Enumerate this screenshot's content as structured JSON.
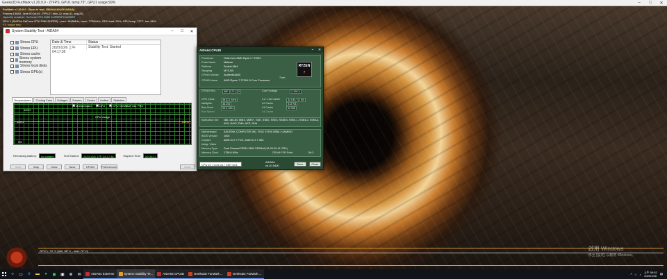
{
  "furmark": {
    "window_title": "Geeks3D FurMark v1.20.9.0 - 27FPS, GPU1 temp:73°, GPU1 usage:99%",
    "overlay": [
      "FurMark v1.20.9.0 - Burn-in test, 2560x1440 (8X MSAA)",
      "Frames:19080 - time:00:06:45 - FPS:27 (min:22, max:31, avg:28)",
      "OpenGL renderer: GeForce RTX 2080 SUPER/PCIe/SSE2",
      "GPU 1 (NVIDIA GeForce RTX 2080 SUPER) - core: 1845MHz, mem: 7750MHz, GPU load: 99%, GPU temp: 73°C, fan: 66%",
      "F1: toggle help"
    ],
    "graph_label": "GPU 1: 73° C (min: 38° C - max: 73° C)",
    "watermark_line1": "啟用 Windows",
    "watermark_line2": "移至 [設定] 以啟用 Windows。"
  },
  "sst": {
    "title": "System Stability Test - AIDA64",
    "stress_options": [
      {
        "label": "Stress CPU",
        "checked": false
      },
      {
        "label": "Stress FPU",
        "checked": true
      },
      {
        "label": "Stress cache",
        "checked": false
      },
      {
        "label": "Stress system memory",
        "checked": false
      },
      {
        "label": "Stress local disks",
        "checked": false
      },
      {
        "label": "Stress GPU(s)",
        "checked": false
      }
    ],
    "table": {
      "col1": "Date & Time",
      "col2": "Status",
      "rows": [
        {
          "datetime": "2020/10/6 上午 04:17:36",
          "status": "Stability Test: Started"
        }
      ]
    },
    "tabs": [
      "Temperatures",
      "Cooling Fans",
      "Voltages",
      "Powers",
      "Clocks",
      "Unified",
      "Statistics"
    ],
    "temp_graph": {
      "legend": [
        "Motherboard",
        "CPU",
        "CPU GIGABAT 811 PRO"
      ],
      "y_top": "100°C",
      "y_bottom": "0°C",
      "value": "78 36"
    },
    "cpu_graph": {
      "title": "CPU Usage",
      "y_top": "100%",
      "y_bottom": "0%",
      "value": "100%"
    },
    "info": {
      "battery_label": "Remaining Battery:",
      "battery_value": "No battery",
      "started_label": "Test Started:",
      "started_value": "2020/10/6 上午 04:17:36",
      "elapsed_label": "Elapsed Time:",
      "elapsed_value": "00:06:21"
    },
    "buttons": {
      "start": "Start",
      "stop": "Stop",
      "clear": "Clear",
      "save": "Save",
      "cpuid": "CPUID",
      "preferences": "Preferences",
      "close": "Close"
    }
  },
  "cpuid": {
    "title": "AIDA64 CPUID",
    "processor": {
      "label": "Processor",
      "value": "Octa-Core AMD Ryzen 7 3700X"
    },
    "code_name": {
      "label": "Code Name",
      "value": "Matisse"
    },
    "platform": {
      "label": "Platform",
      "value": "Socket AM4"
    },
    "stepping": {
      "label": "Stepping",
      "value": "MTS-B0"
    },
    "vendor": {
      "label": "CPUID Vendor",
      "value": "AuthenticAMD",
      "nm": "7 nm"
    },
    "cpuid_name": {
      "label": "CPUID Name",
      "value": "AMD Ryzen 7 3700X 8-Core Processor"
    },
    "rev": {
      "label": "CPUID Rev.",
      "v1": "08F",
      "v2": "71",
      "v3": "0"
    },
    "core_voltage": {
      "label": "Core Voltage",
      "value": "1.100 V"
    },
    "clocks": [
      {
        "label": "CPU Clock",
        "value": "3810.1 MHz"
      },
      {
        "label": "Multiplier",
        "value": "38.25x"
      },
      {
        "label": "Bus Clock",
        "value": "99.6 MHz"
      },
      {
        "label": "Bus Speed",
        "value": ""
      }
    ],
    "caches": [
      {
        "label": "L1 / L1D Cache",
        "value": "32 KB / 32 KB"
      },
      {
        "label": "L2 Cache",
        "value": "512 KB"
      },
      {
        "label": "L3 Cache",
        "value": "32 MB"
      },
      {
        "label": "L4 Cache",
        "value": ""
      }
    ],
    "instruction_set": {
      "label": "Instruction Set",
      "value": "x86, x86-64, MMX, MMX+, SSE, SSE2, SSE3, SSSE3, SSE4.1, SSE4.2, SSE4A, AVX, AVX2, FMA, AES, SHA"
    },
    "board": [
      {
        "label": "Motherboard",
        "value": "ASUSTeK COMPUTER INC. ROG STRIX B550-I GAMING"
      },
      {
        "label": "BIOS Version",
        "value": "1004"
      },
      {
        "label": "Chipset",
        "value": "AMD K17.7 FCH, AMD K17.7 IMC"
      },
      {
        "label": "Integr. Video",
        "value": ""
      },
      {
        "label": "Memory Type",
        "value": "Dual Channel DDR4-3600 SDRAM  (18-20-20-41 CR1)"
      },
      {
        "label": "Memory Clock",
        "value": "1796.6 MHz",
        "ratio_label": "DRAM:FSB Ratio",
        "ratio": "54:3"
      }
    ],
    "selector": "CPU #1 / Core #1 / SMT Unit #1",
    "version": "AIDA64 v6.20.5400",
    "save": "Save",
    "close": "Close",
    "logo_text": "RYZEN",
    "logo_num": "7"
  },
  "taskbar": {
    "apps": [
      {
        "label": "AIDA64 Extreme",
        "color": "#c4302b"
      },
      {
        "label": "System Stability Te...",
        "color": "#e8a020"
      },
      {
        "label": "AIDA64 CPUID",
        "color": "#c4302b"
      },
      {
        "label": "Geeks3D FurMark ...",
        "color": "#d04020"
      },
      {
        "label": "Geeks3D FurMark ...",
        "color": "#d04020"
      }
    ],
    "time": "上午 09:52",
    "date": "2020/10/6"
  }
}
